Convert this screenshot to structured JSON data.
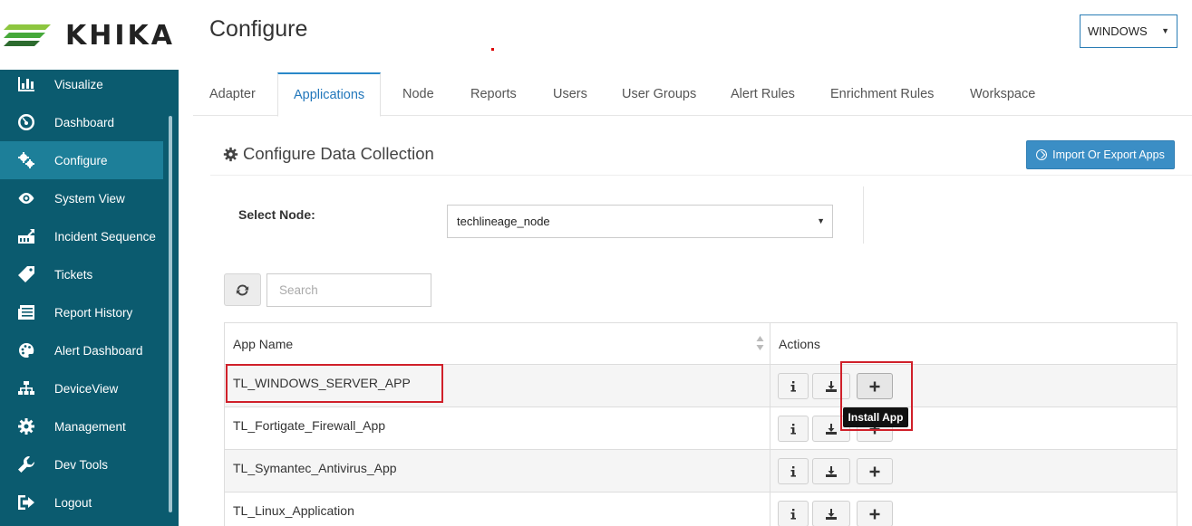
{
  "brand": {
    "name": "KHIKA",
    "logo_colors": [
      "#2d6b2f",
      "#46a83a",
      "#8dc63f"
    ]
  },
  "sidebar": {
    "items": [
      {
        "label": "Visualize",
        "icon": "bar-chart-icon"
      },
      {
        "label": "Dashboard",
        "icon": "dashboard-icon"
      },
      {
        "label": "Configure",
        "icon": "gears-icon",
        "active": true
      },
      {
        "label": "System View",
        "icon": "eye-icon"
      },
      {
        "label": "Incident Sequence",
        "icon": "sequence-icon"
      },
      {
        "label": "Tickets",
        "icon": "tag-icon"
      },
      {
        "label": "Report History",
        "icon": "newspaper-icon"
      },
      {
        "label": "Alert Dashboard",
        "icon": "palette-icon"
      },
      {
        "label": "DeviceView",
        "icon": "sitemap-icon"
      },
      {
        "label": "Management",
        "icon": "gear-icon"
      },
      {
        "label": "Dev Tools",
        "icon": "wrench-icon"
      },
      {
        "label": "Logout",
        "icon": "sign-out-icon"
      }
    ]
  },
  "header": {
    "title": "Configure",
    "os_select": "WINDOWS"
  },
  "tabs": [
    "Adapter",
    "Applications",
    "Node",
    "Reports",
    "Users",
    "User Groups",
    "Alert Rules",
    "Enrichment Rules",
    "Workspace"
  ],
  "active_tab": "Applications",
  "section": {
    "title": "Configure Data Collection",
    "import_button": "Import Or Export Apps"
  },
  "node": {
    "label": "Select Node:",
    "value": "techlineage_node"
  },
  "search": {
    "placeholder": "Search"
  },
  "table": {
    "headers": {
      "name": "App Name",
      "actions": "Actions"
    },
    "rows": [
      {
        "name": "TL_WINDOWS_SERVER_APP"
      },
      {
        "name": "TL_Fortigate_Firewall_App"
      },
      {
        "name": "TL_Symantec_Antivirus_App"
      },
      {
        "name": "TL_Linux_Application"
      }
    ]
  },
  "tooltip": "Install App",
  "colors": {
    "sidebar": "#0b5b6f",
    "sidebar_active": "#1d7f99",
    "accent": "#3b8ec5",
    "highlight": "#d0202a"
  }
}
